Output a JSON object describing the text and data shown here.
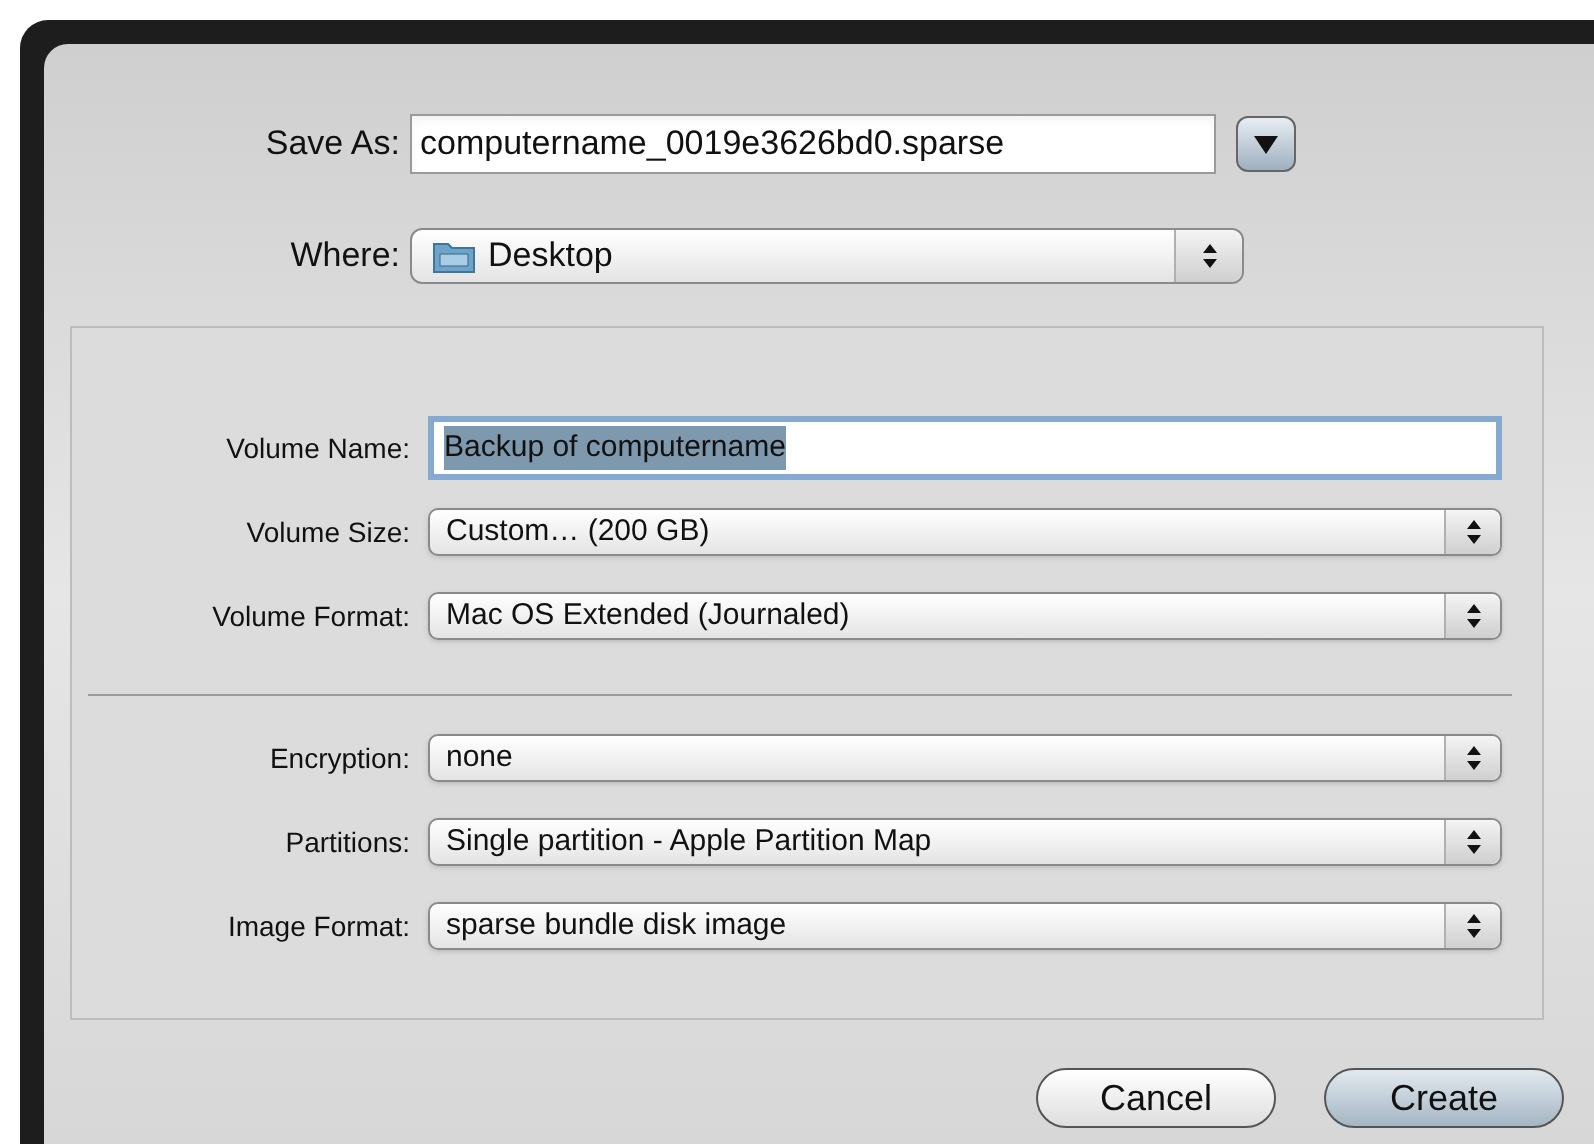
{
  "save_as": {
    "label": "Save As:",
    "value": "computername_0019e3626bd0.sparse",
    "expanded": false
  },
  "where": {
    "label": "Where:",
    "value": "Desktop"
  },
  "options": [
    {
      "kind": "text",
      "label": "Volume Name:",
      "value": "Backup of computername",
      "text_selected": true
    },
    {
      "kind": "popup",
      "label": "Volume Size:",
      "value": "Custom… (200 GB)"
    },
    {
      "kind": "popup",
      "label": "Volume Format:",
      "value": "Mac OS Extended (Journaled)"
    },
    {
      "kind": "separator"
    },
    {
      "kind": "popup",
      "label": "Encryption:",
      "value": "none"
    },
    {
      "kind": "popup",
      "label": "Partitions:",
      "value": "Single partition - Apple Partition Map"
    },
    {
      "kind": "popup",
      "label": "Image Format:",
      "value": "sparse bundle disk image"
    }
  ],
  "buttons": [
    {
      "label": "Cancel",
      "default": false
    },
    {
      "label": "Create",
      "default": true
    }
  ]
}
